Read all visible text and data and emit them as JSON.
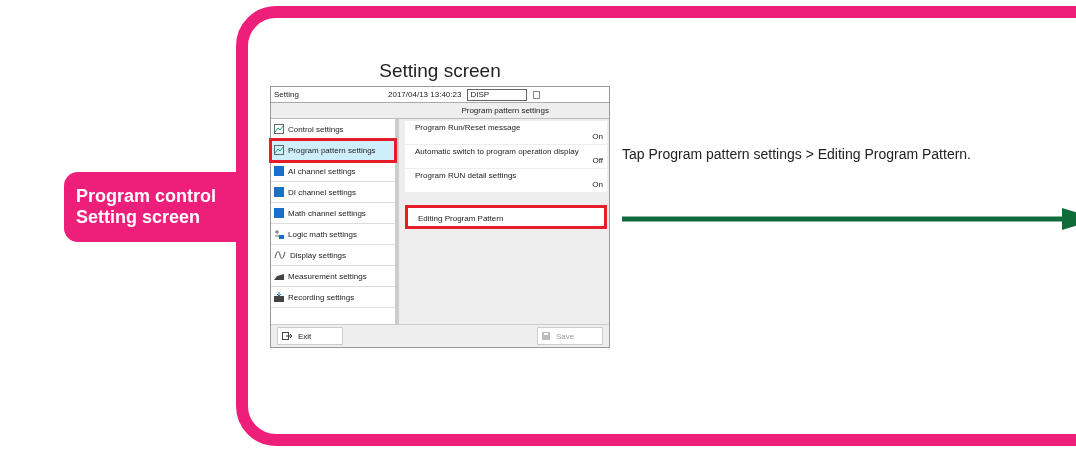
{
  "badge": {
    "text": "Program control Setting screen"
  },
  "panel_title": "Setting screen",
  "screen": {
    "title": "Setting",
    "datetime": "2017/04/13 13:40:23",
    "status_field": "DISP",
    "breadcrumb": "Program pattern settings",
    "sidebar": [
      {
        "label": "Control settings",
        "selected": false,
        "highlighted": false
      },
      {
        "label": "Program pattern settings",
        "selected": true,
        "highlighted": true
      },
      {
        "label": "AI channel settings",
        "selected": false,
        "highlighted": false
      },
      {
        "label": "DI channel settings",
        "selected": false,
        "highlighted": false
      },
      {
        "label": "Math channel settings",
        "selected": false,
        "highlighted": false
      },
      {
        "label": "Logic math settings",
        "selected": false,
        "highlighted": false
      },
      {
        "label": "Display settings",
        "selected": false,
        "highlighted": false
      },
      {
        "label": "Measurement settings",
        "selected": false,
        "highlighted": false
      },
      {
        "label": "Recording settings",
        "selected": false,
        "highlighted": false
      }
    ],
    "settings": [
      {
        "label": "Program Run/Reset message",
        "value": "On",
        "highlighted": false
      },
      {
        "label": "Automatic switch to program operation display",
        "value": "Off",
        "highlighted": false
      },
      {
        "label": "Program RUN detail settings",
        "value": "On",
        "highlighted": false
      },
      {
        "label": "Editing Program Pattern",
        "highlighted": true
      }
    ],
    "buttons": [
      {
        "label": "Exit",
        "disabled": false
      },
      {
        "label": "Save",
        "disabled": true
      }
    ]
  },
  "instruction": "Tap Program pattern settings > Editing Program Pattern."
}
